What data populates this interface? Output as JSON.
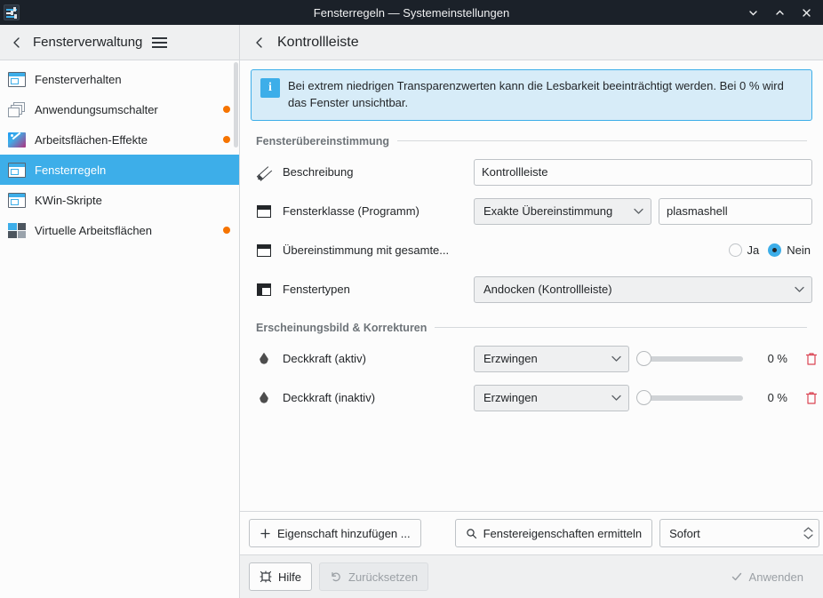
{
  "titlebar": {
    "title": "Fensterregeln — Systemeinstellungen",
    "app_icon": "sliders-icon",
    "buttons": [
      {
        "name": "minimize-button",
        "glyph": "chevron-down"
      },
      {
        "name": "maximize-button",
        "glyph": "chevron-up"
      },
      {
        "name": "close-button",
        "glyph": "x"
      }
    ]
  },
  "sidebar": {
    "header": {
      "back_label": "back-icon",
      "title": "Fensterverwaltung",
      "menu_label": "hamburger-menu-icon"
    },
    "items": [
      {
        "label": "Fensterverhalten",
        "icon": "window-icon",
        "selected": false,
        "modified": false
      },
      {
        "label": "Anwendungsumschalter",
        "icon": "window-stack-icon",
        "selected": false,
        "modified": true
      },
      {
        "label": "Arbeitsflächen-Effekte",
        "icon": "effects-wand-icon",
        "selected": false,
        "modified": true
      },
      {
        "label": "Fensterregeln",
        "icon": "window-rules-icon",
        "selected": true,
        "modified": false
      },
      {
        "label": "KWin-Skripte",
        "icon": "window-script-icon",
        "selected": false,
        "modified": false
      },
      {
        "label": "Virtuelle Arbeitsflächen",
        "icon": "virtual-desktops-icon",
        "selected": false,
        "modified": true
      }
    ]
  },
  "content": {
    "header": {
      "back_label": "back-icon",
      "title": "Kontrollleiste"
    },
    "info": {
      "icon": "info-icon",
      "glyph": "i",
      "text": "Bei extrem niedrigen Transparenzwerten kann die Lesbarkeit beeinträchtigt werden. Bei 0 % wird das Fenster unsichtbar."
    },
    "sections": [
      {
        "title": "Fensterübereinstimmung",
        "rows": [
          {
            "type": "text",
            "icon": "pencil-icon",
            "label": "Beschreibung",
            "value": "Kontrollleiste",
            "placeholder": ""
          },
          {
            "type": "combo-text",
            "icon": "window-frame-icon",
            "label": "Fensterklasse (Programm)",
            "combo_value": "Exakte Übereinstimmung",
            "value": "plasmashell",
            "placeholder": ""
          },
          {
            "type": "radio",
            "icon": "window-frame-icon",
            "label": "Übereinstimmung mit gesamte...",
            "options": [
              {
                "label": "Ja",
                "selected": false
              },
              {
                "label": "Nein",
                "selected": true
              }
            ]
          },
          {
            "type": "combo",
            "icon": "window-titlebar-icon",
            "label": "Fenstertypen",
            "combo_value": "Andocken (Kontrollleiste)"
          }
        ]
      },
      {
        "title": "Erscheinungsbild & Korrekturen",
        "rows": [
          {
            "type": "slider",
            "icon": "opacity-drop-icon",
            "label": "Deckkraft (aktiv)",
            "combo_value": "Erzwingen",
            "percent": "0 %",
            "slider_value": 0,
            "delete_icon": "trash-icon"
          },
          {
            "type": "slider",
            "icon": "opacity-drop-icon",
            "label": "Deckkraft (inaktiv)",
            "combo_value": "Erzwingen",
            "percent": "0 %",
            "slider_value": 0,
            "delete_icon": "trash-icon"
          }
        ]
      }
    ],
    "action_bar": {
      "add_property": "Eigenschaft hinzufügen ...",
      "detect_properties": "Fenstereigenschaften ermitteln",
      "delay_value": "Sofort"
    },
    "footer": {
      "help": "Hilfe",
      "reset": "Zurücksetzen",
      "apply": "Anwenden"
    }
  },
  "colors": {
    "accent": "#3daee9",
    "modified_dot": "#f67400",
    "titlebar_bg": "#1b2129",
    "info_bg": "#d7ecf8",
    "danger": "#da4453"
  }
}
